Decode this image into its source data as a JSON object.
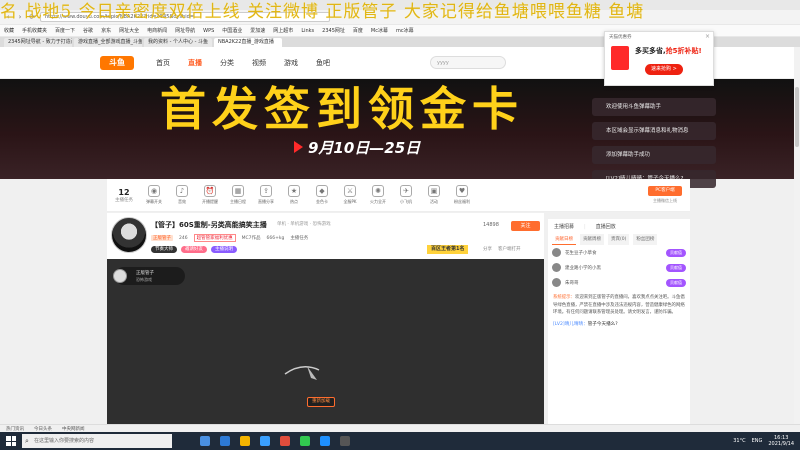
{
  "browser": {
    "url": "https://www.douyu.com/topic/NBA2K22?rid=4545&dyshid=",
    "bookmarks": [
      "收藏",
      "手机收藏夹",
      "百度一下",
      "谷歌",
      "京东",
      "网址大全",
      "电商新闻",
      "网址导航",
      "WPS",
      "中国酒业",
      "爱加速",
      "网上超市",
      "Links",
      "2345网址",
      "百度",
      "Mc冰幕",
      "mc冰幕"
    ],
    "tabs": [
      {
        "label": "2345网址导航 - 致力于打造百",
        "active": false
      },
      {
        "label": "游戏直播_全部游戏直播_斗鱼",
        "active": false
      },
      {
        "label": "我的资料 - 个人中心 - 斗鱼",
        "active": false
      },
      {
        "label": "NBA2K22直播_游戏直播",
        "active": true
      }
    ]
  },
  "danmaku_text": "名 战地5 今日亲密度双倍上线 关注微博 正版管子 大家记得给鱼塘喂喂鱼糖 鱼塘",
  "header": {
    "logo": "斗鱼",
    "nav": [
      "首页",
      "直播",
      "分类",
      "视频",
      "游戏",
      "鱼吧"
    ],
    "active_nav": "直播",
    "search_placeholder": "yyyy"
  },
  "banner": {
    "title": "首发签到领金卡",
    "date_range": "9月10日—25日"
  },
  "chat_popups": [
    "欢迎使用斗鱼弹幕助手",
    "本区域会显示弹幕消息和礼物消息",
    "添加弹幕助手成功",
    "[LV2]晴儿晴晴：管子今天播么?"
  ],
  "toolbar": {
    "count": "12",
    "count_label": "主播任务",
    "items": [
      "弹幕开关",
      "音效",
      "开播提醒",
      "主播日程",
      "直播分享",
      "热点",
      "金色卡",
      "全服PK",
      "火力全开",
      "小飞机",
      "活动",
      "粉丝福利"
    ],
    "right_button": "PC客户端",
    "right_label": "主播微信上线"
  },
  "streamer": {
    "title": "【管子】60S重制-另类高能搞笑主播",
    "category_tags": "单机 · 单机游戏 · 恐怖游戏",
    "name": "正版管子",
    "level": "246",
    "badge": "超管管家福利优惠",
    "sub_meta": [
      "MC7作品",
      "666+kg",
      "主播任务"
    ],
    "pills": [
      {
        "label": "节奏大师",
        "color": "#333333"
      },
      {
        "label": "邀请好友",
        "color": "#ff6d8a"
      },
      {
        "label": "主播说明",
        "color": "#8a5cff"
      }
    ],
    "fans": "14898",
    "follow_label": "关注",
    "rank_badge": "百区王者第1名",
    "share": [
      "分享",
      "客户端打开"
    ]
  },
  "player": {
    "channel_name": "正版管子",
    "channel_sub": "恐怖游戏",
    "loading_tip": "重新加载"
  },
  "right_panel": {
    "head_tabs": [
      "主播招募",
      "直播回放"
    ],
    "rank_tabs": [
      "贡献日榜",
      "贡献周榜",
      "贵宾(0)",
      "粉丝团榜"
    ],
    "rank_rows": [
      {
        "name": "花生豆子小草食",
        "action": "贡献值"
      },
      {
        "name": "建业路小学的小黑",
        "action": "贡献值"
      },
      {
        "name": "朱哥哥",
        "action": "贡献值"
      }
    ],
    "notice_label": "系统提示：",
    "notice_text": "欢迎来到正版管子的直播间，喜欢我点点关注吧。斗鱼倡导绿色直播，严禁在直播中涉及违法违规内容，营造健康绿色的网络环境。有任何问题请联系管理员处理。请文明发言，谨防诈骗。",
    "last_msg_user": "[LV2]晴儿晴晴：",
    "last_msg_text": "管子今天播么?"
  },
  "popup": {
    "title": "天猫优惠券",
    "main_text": "多买多省,",
    "highlight": "抢5折补贴!",
    "button": "速来抢购 >"
  },
  "statusbar": [
    "热门资讯",
    "今日头条",
    "中央网新闻"
  ],
  "taskbar": {
    "search_placeholder": "在这里输入你要搜索的内容",
    "temperature": "31°C",
    "lang": "ENG",
    "time": "16:13",
    "date": "2021/9/14"
  }
}
